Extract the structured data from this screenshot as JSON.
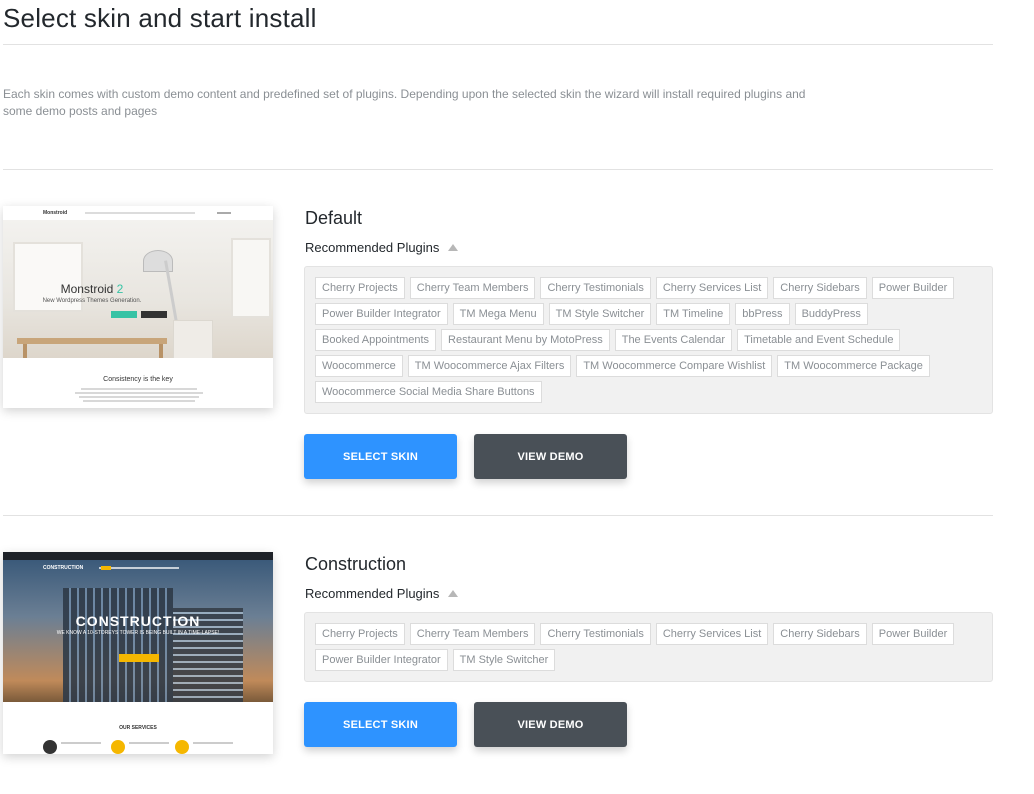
{
  "page": {
    "title": "Select skin and start install",
    "description": "Each skin comes with custom demo content and predefined set of plugins. Depending upon the selected skin the wizard will install required plugins and some demo posts and pages"
  },
  "colors": {
    "select_button": "#2e93ff",
    "demo_button": "#495057"
  },
  "skins": [
    {
      "name": "Default",
      "plugins_label": "Recommended Plugins",
      "plugins": [
        "Cherry Projects",
        "Cherry Team Members",
        "Cherry Testimonials",
        "Cherry Services List",
        "Cherry Sidebars",
        "Power Builder",
        "Power Builder Integrator",
        "TM Mega Menu",
        "TM Style Switcher",
        "TM Timeline",
        "bbPress",
        "BuddyPress",
        "Booked Appointments",
        "Restaurant Menu by MotoPress",
        "The Events Calendar",
        "Timetable and Event Schedule",
        "Woocommerce",
        "TM Woocommerce Ajax Filters",
        "TM Woocommerce Compare Wishlist",
        "TM Woocommerce Package",
        "Woocommerce Social Media Share Buttons"
      ],
      "select_label": "SELECT SKIN",
      "demo_label": "VIEW DEMO",
      "thumb": {
        "brand": "Monstroid",
        "hero_title": "Monstroid",
        "hero_version": "2",
        "hero_sub": "New Wordpress Themes Generation.",
        "section_title": "Consistency is the key"
      }
    },
    {
      "name": "Construction",
      "plugins_label": "Recommended Plugins",
      "plugins": [
        "Cherry Projects",
        "Cherry Team Members",
        "Cherry Testimonials",
        "Cherry Services List",
        "Cherry Sidebars",
        "Power Builder",
        "Power Builder Integrator",
        "TM Style Switcher"
      ],
      "select_label": "SELECT SKIN",
      "demo_label": "VIEW DEMO",
      "thumb": {
        "brand": "CONSTRUCTION",
        "hero_title": "CONSTRUCTION",
        "hero_sub": "WE KNOW A 10-STOREYS TOWER IS BEING BUILT IN A TIME-LAPSE!",
        "section_title": "OUR SERVICES"
      }
    }
  ]
}
